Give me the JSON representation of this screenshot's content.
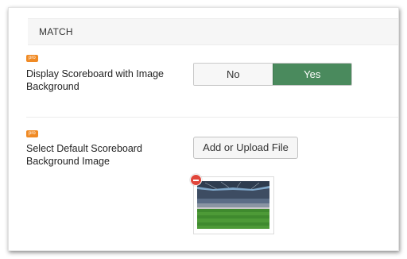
{
  "section": {
    "title": "MATCH"
  },
  "fields": [
    {
      "badge": "pro",
      "label": "Display Scoreboard with Image Background",
      "options": [
        "No",
        "Yes"
      ],
      "selected": "Yes"
    },
    {
      "badge": "pro",
      "label": "Select Default Scoreboard Background Image",
      "button_label": "Add or Upload File",
      "image": "stadium-photo"
    }
  ],
  "colors": {
    "selected_option": "#4a8a5d",
    "pro_badge": "#f08a24",
    "remove_icon": "#e0453a"
  }
}
